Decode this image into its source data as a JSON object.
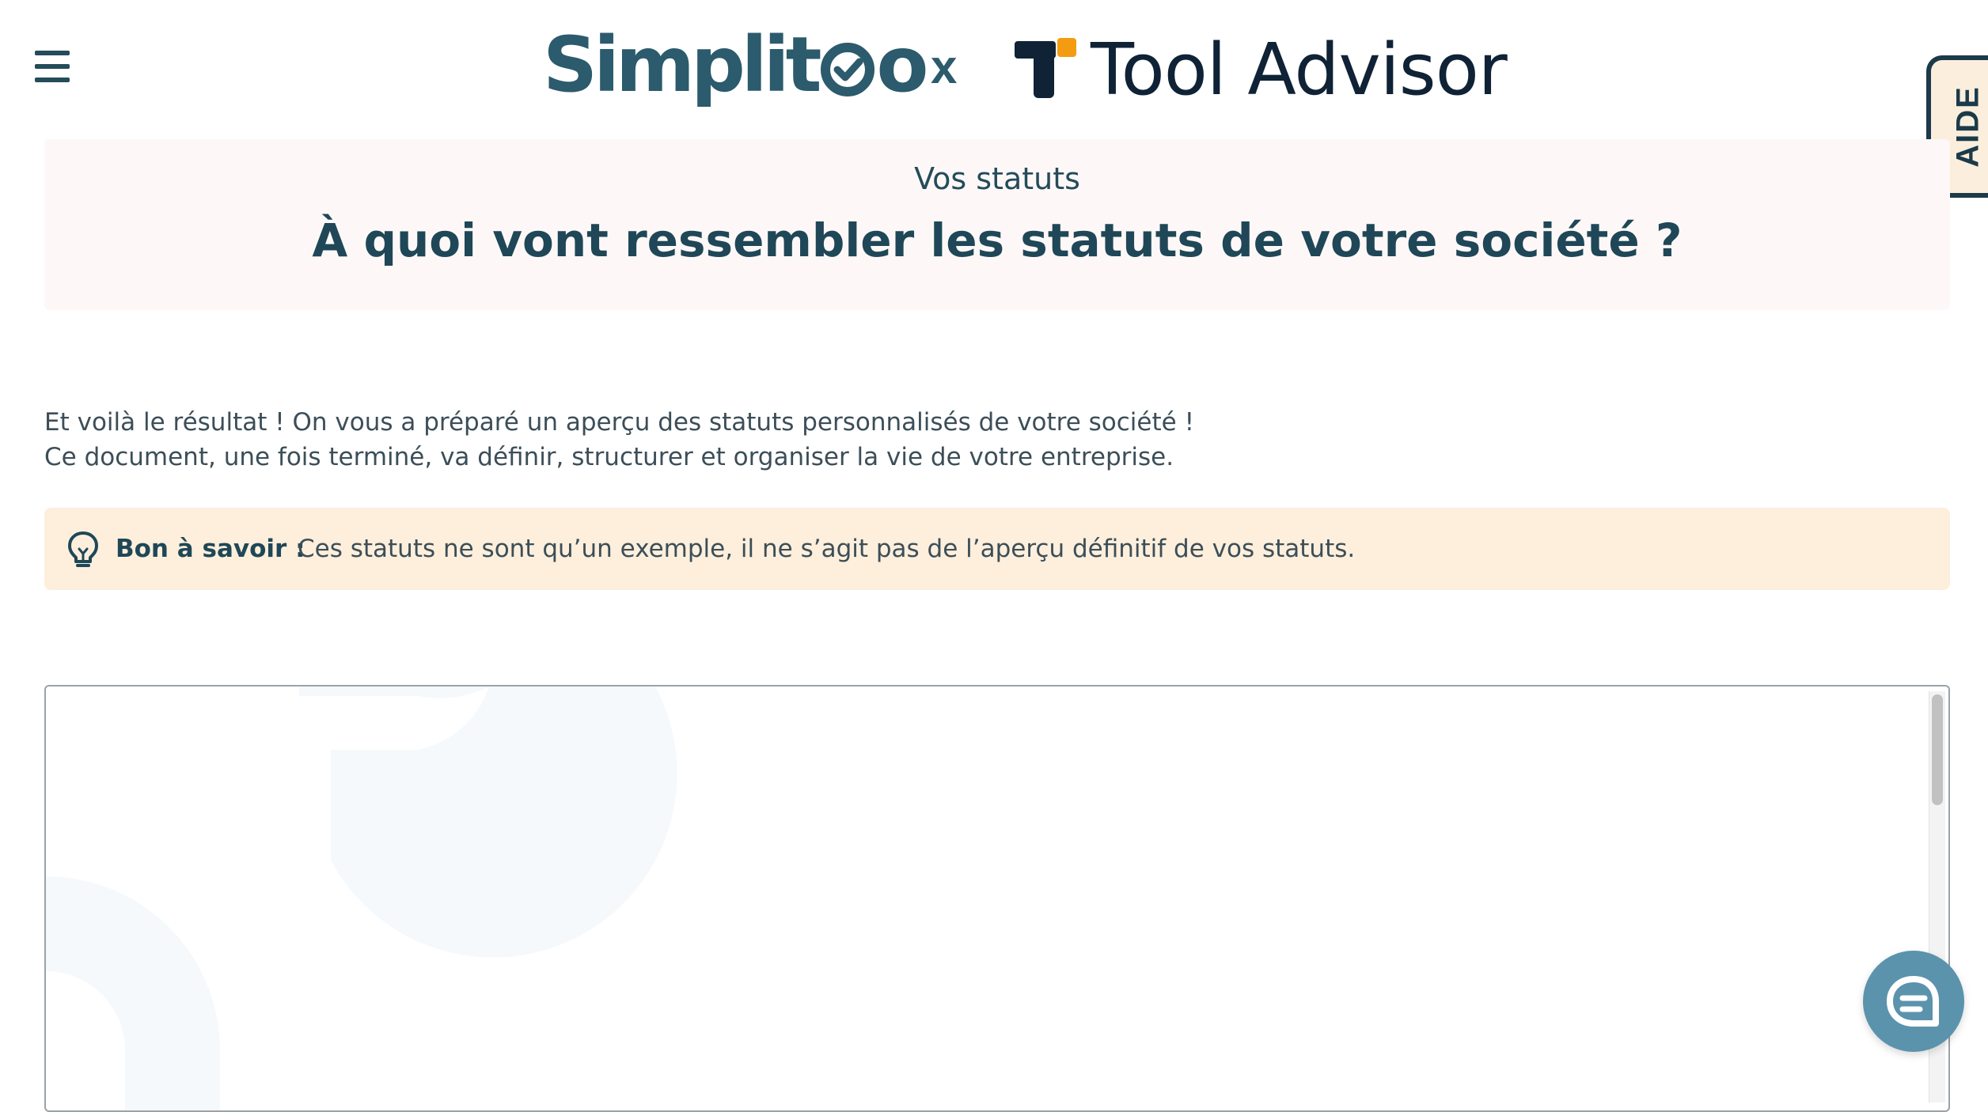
{
  "header": {
    "brand_left": "Simplitoo",
    "brand_left_parts": [
      "Simplit",
      "o"
    ],
    "separator": "x",
    "brand_right": "Tool Advisor"
  },
  "aide_tab": {
    "label": "AIDE"
  },
  "title_banner": {
    "eyebrow": "Vos statuts",
    "title": "À quoi vont ressembler les statuts de votre société ?"
  },
  "intro": {
    "line1": "Et voilà le résultat ! On vous a préparé un aperçu des statuts personnalisés de votre société !",
    "line2": "Ce document, une fois terminé, va définir, structurer et organiser la vie de votre entreprise."
  },
  "info_box": {
    "label": "Bon à savoir :",
    "text": "Ces statuts ne sont qu’un exemple, il ne s’agit pas de l’aperçu définitif de vos statuts."
  },
  "icons": {
    "menu": "hamburger-icon",
    "tip": "lightbulb-icon",
    "chat": "chat-icon",
    "brand_mark": "tooladvisor-logo-icon"
  },
  "colors": {
    "primary": "#244c5a",
    "banner_bg": "#fdf8f7",
    "info_bg": "#fdefdc",
    "aide_bg": "#fbeedc",
    "chat_bg": "#5b93ad",
    "tooladvisor_orange": "#f39c12",
    "tooladvisor_navy": "#0f2236"
  }
}
